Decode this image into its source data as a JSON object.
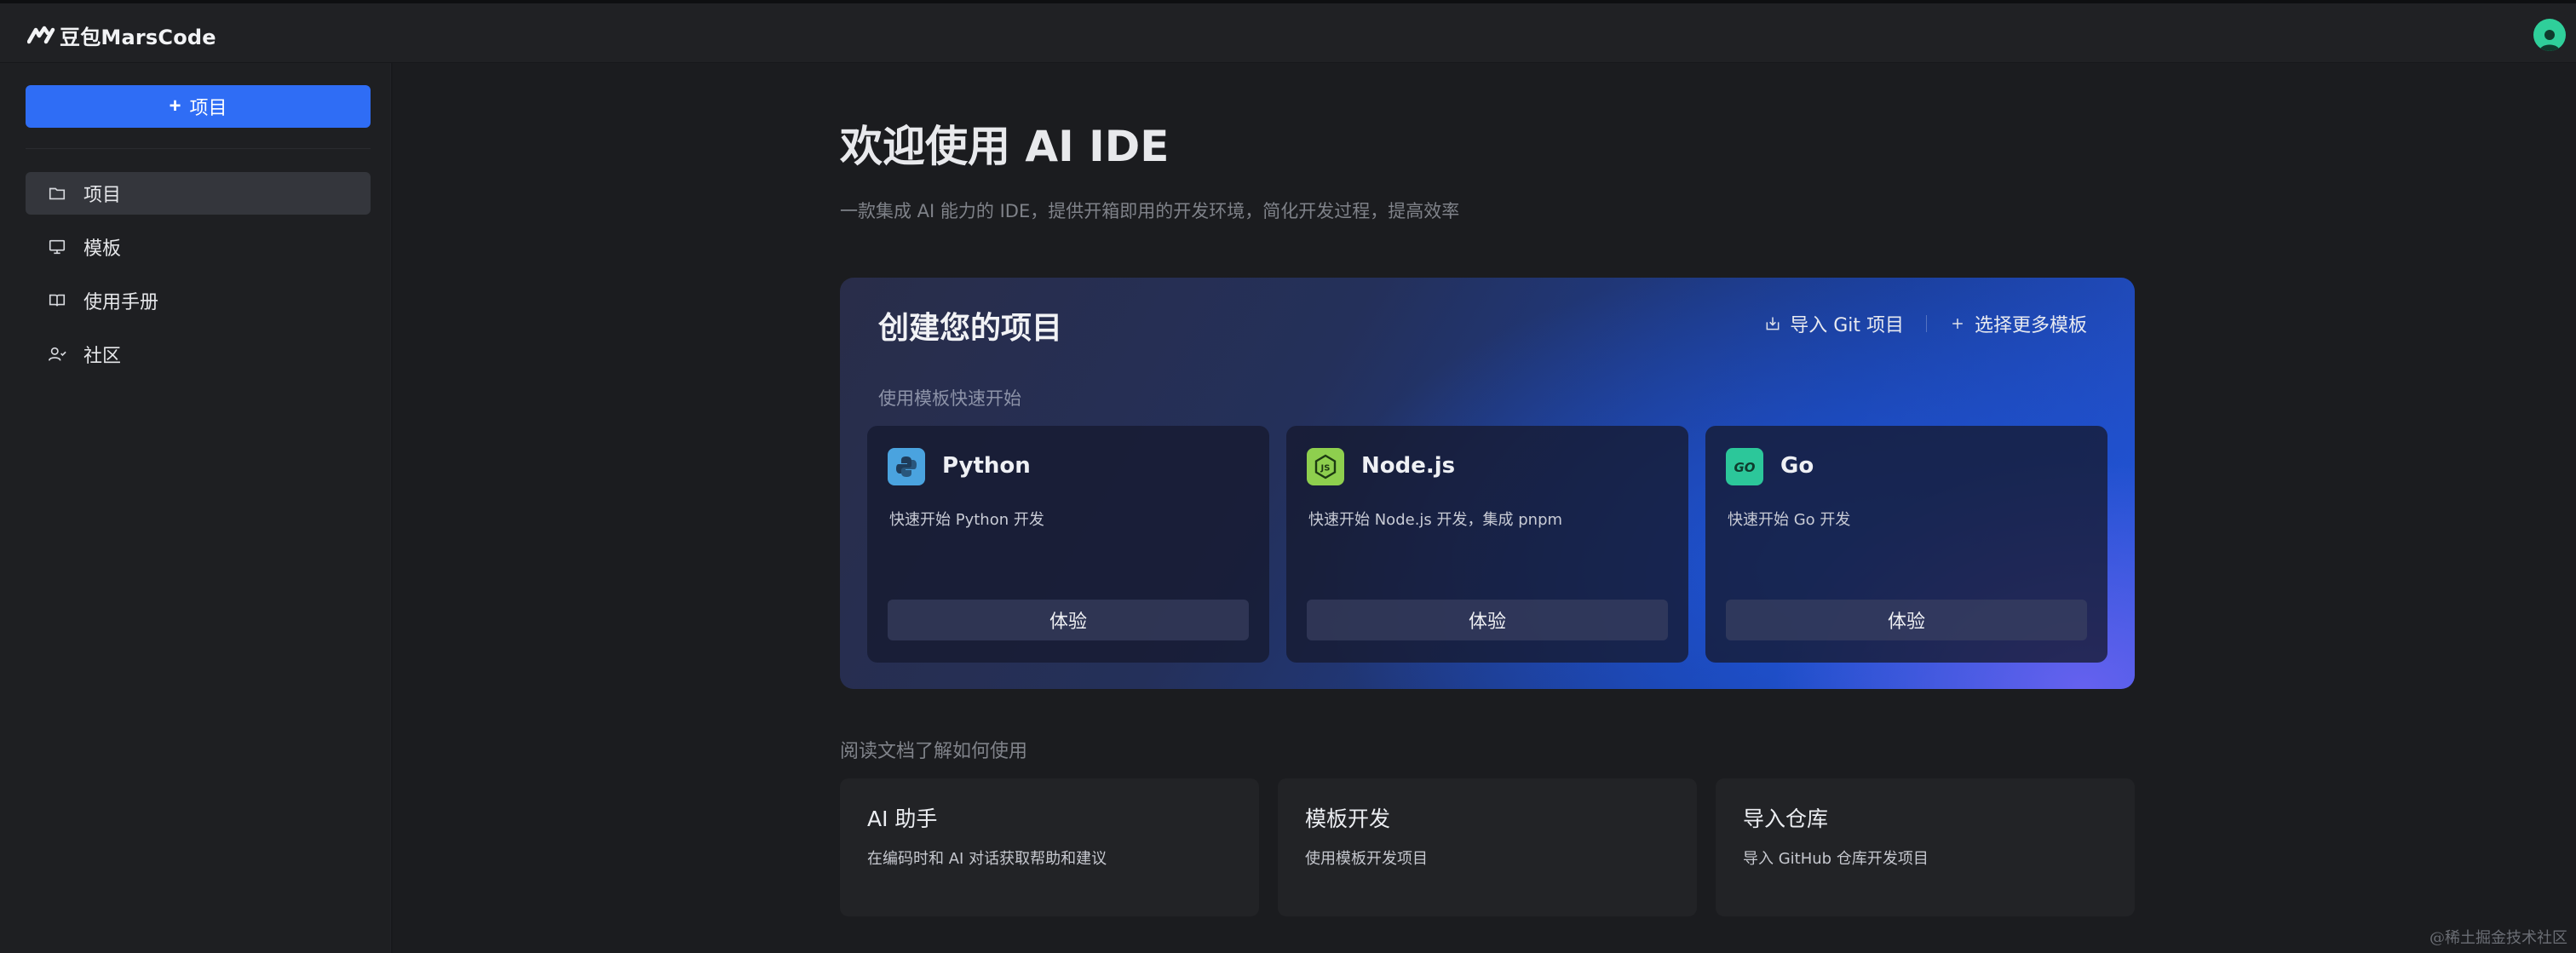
{
  "topbar": {
    "logo_text": "豆包MarsCode"
  },
  "sidebar": {
    "new_button_label": "项目",
    "items": [
      {
        "label": "项目",
        "icon": "folder-icon",
        "active": true
      },
      {
        "label": "模板",
        "icon": "monitor-icon",
        "active": false
      },
      {
        "label": "使用手册",
        "icon": "book-icon",
        "active": false
      },
      {
        "label": "社区",
        "icon": "community-icon",
        "active": false
      }
    ]
  },
  "main": {
    "title": "欢迎使用 AI IDE",
    "subtitle": "一款集成 AI 能力的 IDE，提供开箱即用的开发环境，简化开发过程，提高效率"
  },
  "create_panel": {
    "title": "创建您的项目",
    "import_git_label": "导入 Git 项目",
    "more_templates_label": "选择更多模板",
    "subtitle": "使用模板快速开始",
    "templates": [
      {
        "name": "Python",
        "desc": "快速开始 Python 开发",
        "button": "体验",
        "icon": "python-icon",
        "color": "#4aa3df"
      },
      {
        "name": "Node.js",
        "desc": "快速开始 Node.js 开发，集成 pnpm",
        "button": "体验",
        "icon": "nodejs-icon",
        "color": "#8ecf4e"
      },
      {
        "name": "Go",
        "desc": "快速开始 Go 开发",
        "button": "体验",
        "icon": "go-icon",
        "color": "#2cc79a"
      }
    ]
  },
  "docs": {
    "label": "阅读文档了解如何使用",
    "cards": [
      {
        "title": "AI 助手",
        "desc": "在编码时和 AI 对话获取帮助和建议"
      },
      {
        "title": "模板开发",
        "desc": "使用模板开发项目"
      },
      {
        "title": "导入仓库",
        "desc": "导入 GitHub 仓库开发项目"
      }
    ]
  },
  "watermark": "@稀土掘金技术社区",
  "colors": {
    "primary": "#2f6df5",
    "avatar": "#2fcf9a",
    "background": "#1b1c1f"
  }
}
